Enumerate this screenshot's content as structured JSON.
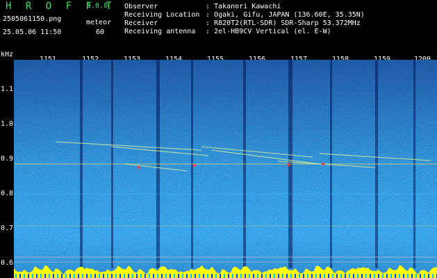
{
  "header": {
    "app_title": "H R O F F T",
    "app_version": "1.0.0",
    "file_name": "2505061150.png",
    "mode": "meteor",
    "timestamp": "25.05.06 11:50",
    "count": "60"
  },
  "station_info": [
    {
      "key": "Observer",
      "value": "Takanori Kawachi"
    },
    {
      "key": "Receiving Location",
      "value": "Ogaki, Gifu, JAPAN (136.60E, 35.35N)"
    },
    {
      "key": "Receiver",
      "value": "R820T2(RTL-SDR) SDR-Sharp 53.372MHz"
    },
    {
      "key": "Receiving antenna",
      "value": "2el-HB9CV Vertical (el. E-W)"
    }
  ],
  "axis": {
    "y_unit": "kHz",
    "y_ticks": [
      "1.1",
      "1.0",
      "0.9",
      "0.8",
      "0.7",
      "0.6"
    ],
    "x_ticks": [
      "1151",
      "1152",
      "1153",
      "1154",
      "1155",
      "1156",
      "1157",
      "1158",
      "1159",
      "1200"
    ]
  },
  "colors": {
    "title_green": "#3fe06a",
    "text": "#ffffff",
    "background_noise": "#1a3a9c",
    "signal_line": "#f0e060",
    "bottom_band": "#ffff00"
  }
}
